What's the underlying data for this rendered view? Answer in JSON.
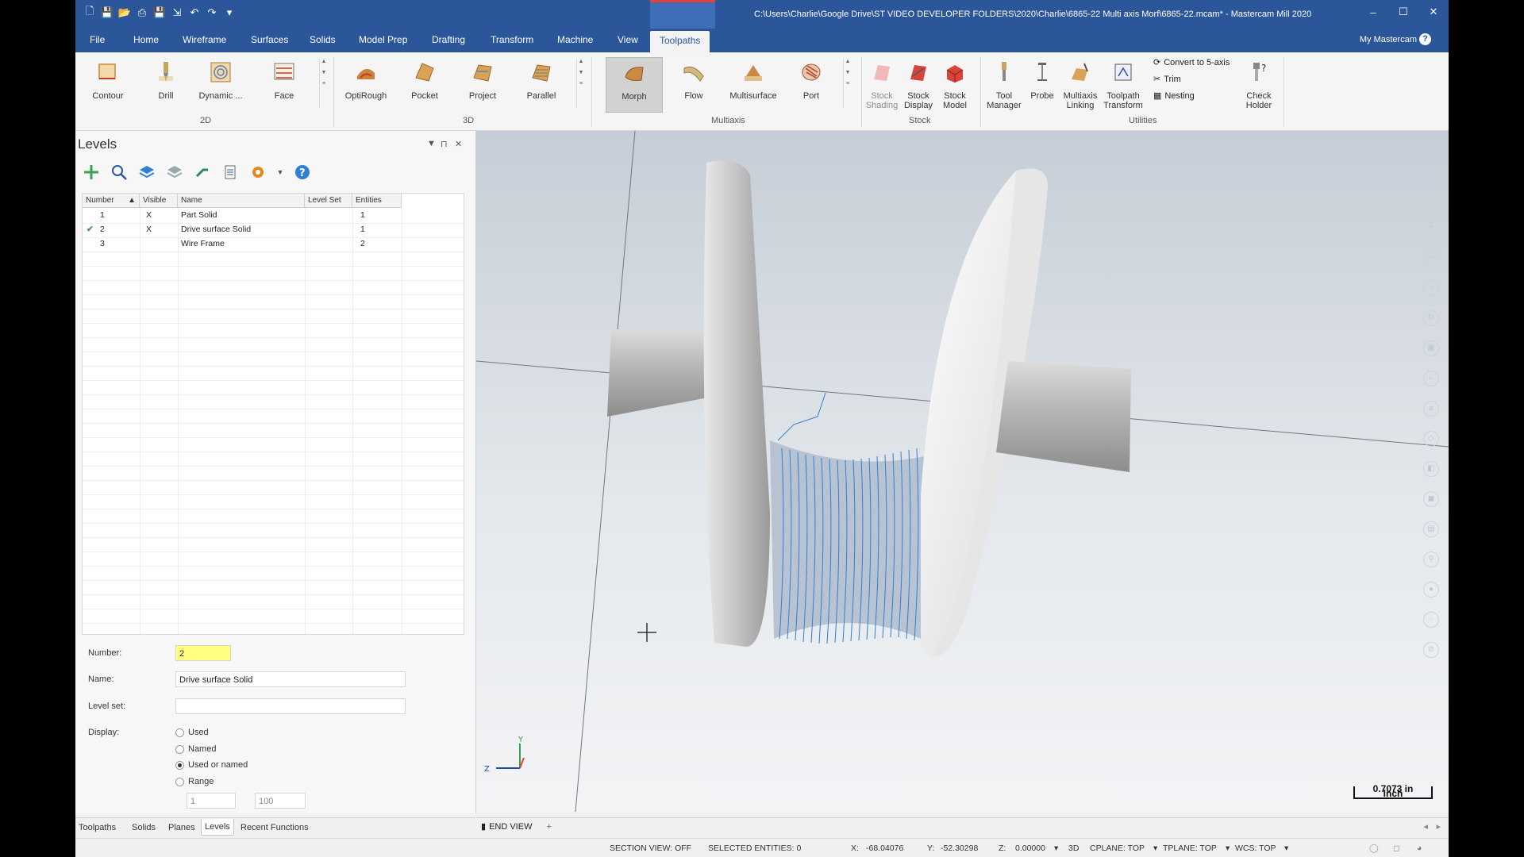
{
  "titlebar": {
    "path": "C:\\Users\\Charlie\\Google Drive\\ST VIDEO DEVELOPER FOLDERS\\2020\\Charlie\\6865-22 Multi axis Morf\\6865-22.mcam* - Mastercam Mill 2020",
    "minimize": "–",
    "maximize": "☐",
    "close": "✕"
  },
  "menu": {
    "items": [
      "File",
      "Home",
      "Wireframe",
      "Surfaces",
      "Solids",
      "Model Prep",
      "Drafting",
      "Transform",
      "Machine",
      "View",
      "Toolpaths"
    ],
    "right": "My Mastercam",
    "help": "?"
  },
  "ribbon": {
    "group_2d": {
      "label": "2D",
      "buttons": [
        "Contour",
        "Drill",
        "Dynamic ...",
        "Face"
      ]
    },
    "group_3d": {
      "label": "3D",
      "buttons": [
        "OptiRough",
        "Pocket",
        "Project",
        "Parallel"
      ]
    },
    "group_multiaxis": {
      "label": "Multiaxis",
      "buttons": [
        "Morph",
        "Flow",
        "Multisurface",
        "Port"
      ]
    },
    "group_stock": {
      "label": "Stock",
      "buttons": [
        "Stock\nShading",
        "Stock\nDisplay",
        "Stock\nModel"
      ]
    },
    "group_utilities": {
      "label": "Utilities",
      "buttons": [
        "Tool\nManager",
        "Probe",
        "Multiaxis\nLinking",
        "Toolpath\nTransform",
        "Check\nHolder"
      ],
      "small": [
        "Convert to 5-axis",
        "Trim",
        "Nesting"
      ]
    }
  },
  "levels": {
    "title": "Levels",
    "columns": [
      "Number",
      "Visible",
      "Name",
      "Level Set",
      "Entities"
    ],
    "rows": [
      {
        "number": "1",
        "visible": "X",
        "name": "Part Solid",
        "levelset": "",
        "entities": "1",
        "active": false
      },
      {
        "number": "2",
        "visible": "X",
        "name": "Drive surface Solid",
        "levelset": "",
        "entities": "1",
        "active": true
      },
      {
        "number": "3",
        "visible": "",
        "name": "Wire Frame",
        "levelset": "",
        "entities": "2",
        "active": false
      }
    ],
    "props": {
      "number_label": "Number:",
      "number_value": "2",
      "name_label": "Name:",
      "name_value": "Drive surface Solid",
      "levelset_label": "Level set:",
      "levelset_value": "",
      "display_label": "Display:",
      "options": [
        "Used",
        "Named",
        "Used or named",
        "Range"
      ],
      "selected_option": "Used or named",
      "range_from": "1",
      "range_to": "100"
    },
    "tabs": [
      "Toolpaths",
      "Solids",
      "Planes",
      "Levels",
      "Recent Functions"
    ],
    "active_tab": "Levels"
  },
  "viewport": {
    "view_tab": "END VIEW",
    "scale_value": "0.7073 in",
    "scale_unit": "Inch",
    "axis_y": "Y",
    "axis_z": "Z"
  },
  "status": {
    "section_view": "SECTION VIEW: OFF",
    "selected": "SELECTED ENTITIES: 0",
    "x_label": "X:",
    "x_value": "-68.04076",
    "y_label": "Y:",
    "y_value": "-52.30298",
    "z_label": "Z:",
    "z_value": "0.00000",
    "mode": "3D",
    "cplane": "CPLANE: TOP",
    "tplane": "TPLANE: TOP",
    "wcs": "WCS: TOP"
  },
  "colors": {
    "accent": "#2b579a",
    "toolpath": "#2f7fd6",
    "highlight": "#ffff80"
  }
}
